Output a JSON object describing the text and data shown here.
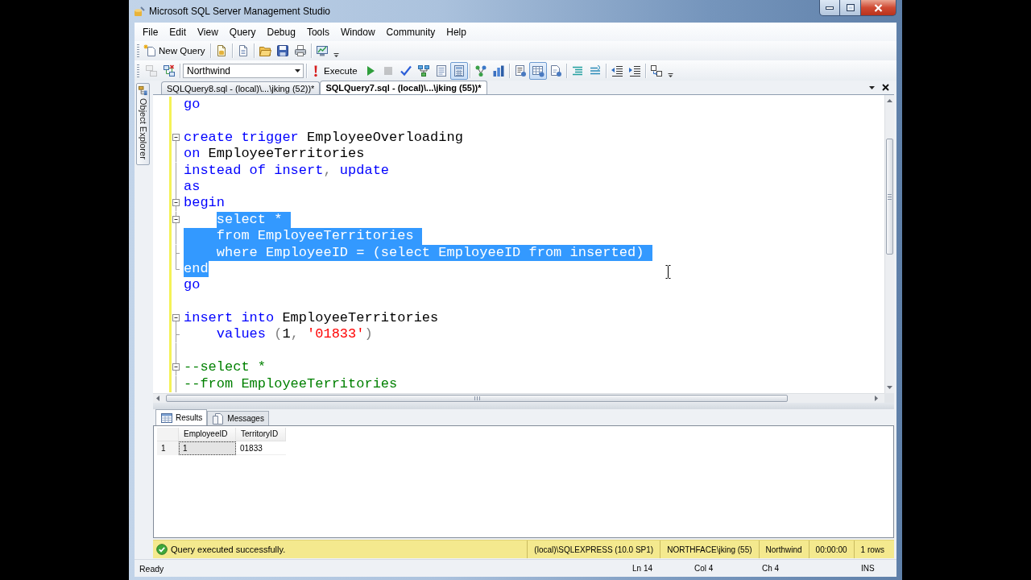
{
  "window": {
    "title": "Microsoft SQL Server Management Studio"
  },
  "menu": [
    "File",
    "Edit",
    "View",
    "Query",
    "Debug",
    "Tools",
    "Window",
    "Community",
    "Help"
  ],
  "toolbar_standard": {
    "new_query": "New Query"
  },
  "toolbar_editor": {
    "groups": [
      [
        {
          "kind": "icon",
          "pressed": false,
          "disabled": true
        },
        {
          "kind": "icon",
          "pressed": false,
          "disabled": false
        }
      ],
      [
        {
          "kind": "dropdown",
          "value": "Northwind"
        }
      ],
      [
        {
          "kind": "text_button",
          "label": "Execute"
        },
        {
          "kind": "icon",
          "pressed": false,
          "disabled": false
        },
        {
          "kind": "icon",
          "pressed": false,
          "disabled": true
        },
        {
          "kind": "icon",
          "pressed": false,
          "disabled": false
        },
        {
          "kind": "icon",
          "pressed": false,
          "disabled": false
        },
        {
          "kind": "icon",
          "pressed": false,
          "disabled": false
        },
        {
          "kind": "icon",
          "pressed": true,
          "disabled": false
        }
      ],
      [
        {
          "kind": "icon",
          "pressed": false,
          "disabled": false
        },
        {
          "kind": "icon",
          "pressed": false,
          "disabled": false
        }
      ],
      [
        {
          "kind": "icon",
          "pressed": false,
          "disabled": false
        },
        {
          "kind": "icon",
          "pressed": true,
          "disabled": false
        },
        {
          "kind": "icon",
          "pressed": false,
          "disabled": false
        }
      ],
      [
        {
          "kind": "icon",
          "pressed": false,
          "disabled": false
        },
        {
          "kind": "icon",
          "pressed": false,
          "disabled": false
        }
      ],
      [
        {
          "kind": "icon",
          "pressed": false,
          "disabled": false
        },
        {
          "kind": "icon",
          "pressed": false,
          "disabled": false
        }
      ],
      [
        {
          "kind": "icon",
          "pressed": false,
          "disabled": false
        }
      ]
    ]
  },
  "side_panel": {
    "label": "Object Explorer"
  },
  "document_tabs": [
    {
      "label": "SQLQuery8.sql - (local)\\...\\jking (52))*",
      "selected": false
    },
    {
      "label": "SQLQuery7.sql - (local)\\...\\jking (55))*",
      "selected": true
    }
  ],
  "editor": {
    "lines": [
      {
        "changed": true,
        "indented": false,
        "eol_selected": false,
        "tokens": [
          {
            "text": "go",
            "kind": "keyword",
            "selected": false
          }
        ]
      },
      {
        "changed": true,
        "eol_selected": false
      },
      {
        "changed": true,
        "indented": false,
        "eol_selected": false,
        "outline": {
          "kind": "toggle",
          "expanded": true
        },
        "tokens": [
          {
            "text": "create trigger",
            "kind": "keyword",
            "selected": false
          },
          {
            "text": " EmployeeOverloading",
            "kind": "identifier",
            "selected": false
          }
        ]
      },
      {
        "changed": true,
        "indented": false,
        "eol_selected": false,
        "outline": {
          "kind": "bar"
        },
        "tokens": [
          {
            "text": "on",
            "kind": "keyword",
            "selected": false
          },
          {
            "text": " EmployeeTerritories",
            "kind": "identifier",
            "selected": false
          }
        ]
      },
      {
        "changed": true,
        "indented": false,
        "eol_selected": false,
        "outline": {
          "kind": "bar"
        },
        "tokens": [
          {
            "text": "instead of insert",
            "kind": "keyword",
            "selected": false
          },
          {
            "text": ",",
            "kind": "operator",
            "selected": false
          },
          {
            "text": " update",
            "kind": "keyword",
            "selected": false
          }
        ]
      },
      {
        "changed": true,
        "indented": false,
        "eol_selected": false,
        "outline": {
          "kind": "bar"
        },
        "tokens": [
          {
            "text": "as",
            "kind": "keyword",
            "selected": false
          }
        ]
      },
      {
        "changed": true,
        "indented": false,
        "eol_selected": false,
        "outline": {
          "kind": "toggle",
          "expanded": true
        },
        "tokens": [
          {
            "text": "begin",
            "kind": "keyword",
            "selected": false
          }
        ]
      },
      {
        "changed": true,
        "indented": true,
        "eol_selected": true,
        "outline": {
          "kind": "toggle",
          "expanded": true
        },
        "tokens": [
          {
            "text": "select",
            "kind": "keyword",
            "selected": true
          },
          {
            "text": " *",
            "kind": "operator",
            "selected": true
          }
        ]
      },
      {
        "changed": true,
        "indented": false,
        "eol_selected": true,
        "outline": {
          "kind": "bar"
        },
        "tokens": [
          {
            "text": "    from",
            "kind": "keyword",
            "selected": true
          },
          {
            "text": " EmployeeTerritories",
            "kind": "identifier",
            "selected": true
          }
        ]
      },
      {
        "changed": true,
        "indented": false,
        "eol_selected": true,
        "outline": {
          "kind": "tee"
        },
        "tokens": [
          {
            "text": "    where",
            "kind": "keyword",
            "selected": true
          },
          {
            "text": " EmployeeID",
            "kind": "identifier",
            "selected": true
          },
          {
            "text": " =",
            "kind": "operator",
            "selected": true
          },
          {
            "text": " (",
            "kind": "operator",
            "selected": true
          },
          {
            "text": "select",
            "kind": "keyword",
            "selected": true
          },
          {
            "text": " EmployeeID",
            "kind": "identifier",
            "selected": true
          },
          {
            "text": " from",
            "kind": "keyword",
            "selected": true
          },
          {
            "text": " inserted",
            "kind": "identifier",
            "selected": true
          },
          {
            "text": ")",
            "kind": "operator",
            "selected": true
          }
        ]
      },
      {
        "changed": true,
        "indented": false,
        "eol_selected": false,
        "outline": {
          "kind": "corner"
        },
        "tokens": [
          {
            "text": "end",
            "kind": "keyword",
            "selected": true
          }
        ]
      },
      {
        "changed": true,
        "indented": false,
        "eol_selected": false,
        "tokens": [
          {
            "text": "go",
            "kind": "keyword",
            "selected": false
          }
        ]
      },
      {
        "changed": true,
        "eol_selected": false
      },
      {
        "changed": true,
        "indented": false,
        "eol_selected": false,
        "outline": {
          "kind": "toggle",
          "expanded": true
        },
        "tokens": [
          {
            "text": "insert into",
            "kind": "keyword",
            "selected": false
          },
          {
            "text": " EmployeeTerritories",
            "kind": "identifier",
            "selected": false
          }
        ]
      },
      {
        "changed": true,
        "indented": false,
        "eol_selected": false,
        "outline": {
          "kind": "tee"
        },
        "tokens": [
          {
            "text": "    values",
            "kind": "keyword",
            "selected": false
          },
          {
            "text": " (",
            "kind": "operator",
            "selected": false
          },
          {
            "text": "1",
            "kind": "number",
            "selected": false
          },
          {
            "text": ",",
            "kind": "operator",
            "selected": false
          },
          {
            "text": " '01833'",
            "kind": "string",
            "selected": false
          },
          {
            "text": ")",
            "kind": "operator",
            "selected": false
          }
        ]
      },
      {
        "changed": true,
        "eol_selected": false,
        "outline": {
          "kind": "bar"
        }
      },
      {
        "changed": true,
        "indented": false,
        "eol_selected": false,
        "outline": {
          "kind": "toggle",
          "expanded": true
        },
        "tokens": [
          {
            "text": "--select *",
            "kind": "comment",
            "selected": false
          }
        ]
      },
      {
        "changed": true,
        "indented": false,
        "eol_selected": false,
        "outline": {
          "kind": "bar"
        },
        "tokens": [
          {
            "text": "--from EmployeeTerritories",
            "kind": "comment",
            "selected": false
          }
        ]
      }
    ]
  },
  "results": {
    "tabs": [
      {
        "label": "Results",
        "selected": true
      },
      {
        "label": "Messages",
        "selected": false
      }
    ],
    "grid": {
      "columns": [
        "EmployeeID",
        "TerritoryID"
      ],
      "rows": [
        {
          "number": "1",
          "cells": [
            {
              "text": "1",
              "selected": true
            },
            {
              "text": "01833",
              "selected": false
            }
          ]
        }
      ]
    }
  },
  "query_status": {
    "message": "Query executed successfully.",
    "segments": [
      "(local)\\SQLEXPRESS (10.0 SP1)",
      "NORTHFACE\\jking (55)",
      "Northwind",
      "00:00:00",
      "1 rows"
    ]
  },
  "status_bar": {
    "text": "Ready",
    "line": "Ln 14",
    "column": "Col 4",
    "character": "Ch 4",
    "mode": "INS"
  }
}
